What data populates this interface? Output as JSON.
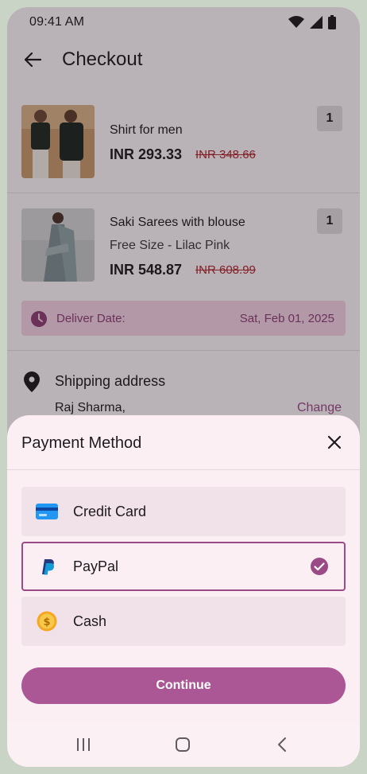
{
  "status_bar": {
    "time": "09:41 AM"
  },
  "app_bar": {
    "title": "Checkout"
  },
  "products": [
    {
      "name": "Shirt for men",
      "variant": "",
      "price": "INR 293.33",
      "old_price": "INR 348.66",
      "quantity": "1"
    },
    {
      "name": "Saki Sarees with blouse",
      "variant": "Free Size - Lilac Pink",
      "price": "INR 548.87",
      "old_price": "INR 608.99",
      "quantity": "1"
    }
  ],
  "delivery": {
    "label": "Deliver Date:",
    "value": "Sat, Feb 01, 2025"
  },
  "shipping": {
    "title": "Shipping address",
    "name": "Raj Sharma,",
    "change_label": "Change"
  },
  "payment_sheet": {
    "title": "Payment Method",
    "options": [
      {
        "label": "Credit Card",
        "icon": "credit-card-icon",
        "selected": false
      },
      {
        "label": "PayPal",
        "icon": "paypal-icon",
        "selected": true
      },
      {
        "label": "Cash",
        "icon": "cash-coin-icon",
        "selected": false
      }
    ],
    "continue_label": "Continue"
  },
  "colors": {
    "accent": "#ab5795",
    "accent_dark": "#9b4a86",
    "delivery_bg": "#f4d2e5",
    "strike_price": "#b0262e"
  }
}
